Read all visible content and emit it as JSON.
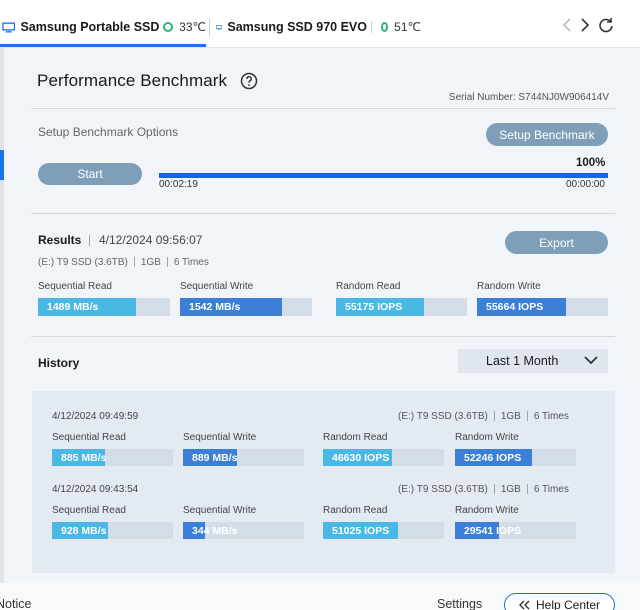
{
  "tabs": [
    {
      "name": "Samsung Portable SSD",
      "temp": "33℃",
      "active": true
    },
    {
      "name": "Samsung SSD 970 EVO",
      "temp": "51℃",
      "active": false
    }
  ],
  "colors": {
    "accent": "#1a73e8",
    "button": "#7f9fb8",
    "status_ok": "#2bb673",
    "bar_light": "#4ab8e4",
    "bar_dark": "#3b7fd6"
  },
  "benchmark": {
    "title": "Performance Benchmark",
    "serial": "Serial Number: S744NJ0W906414V",
    "setup_label": "Setup Benchmark Options",
    "setup_button": "Setup Benchmark",
    "start_button": "Start",
    "progress_percent_label": "100%",
    "progress_fraction": 1.0,
    "elapsed": "00:02:19",
    "remaining": "00:00:00"
  },
  "results": {
    "title": "Results",
    "date": "4/12/2024 09:56:07",
    "export_button": "Export",
    "drive": "(E:) T9 SSD (3.6TB)",
    "size": "1GB",
    "times": "6 Times",
    "metrics": [
      {
        "label": "Sequential Read",
        "value": "1489 MB/s",
        "fraction": 0.74
      },
      {
        "label": "Sequential Write",
        "value": "1542 MB/s",
        "fraction": 0.77
      },
      {
        "label": "Random Read",
        "value": "55175 IOPS",
        "fraction": 0.67
      },
      {
        "label": "Random Write",
        "value": "55664 IOPS",
        "fraction": 0.68
      }
    ]
  },
  "history": {
    "title": "History",
    "filter": "Last 1 Month",
    "entries": [
      {
        "date": "4/12/2024 09:49:59",
        "drive": "(E:) T9 SSD  (3.6TB)",
        "size": "1GB",
        "times": "6 Times",
        "metrics": [
          {
            "label": "Sequential Read",
            "value": "885 MB/s",
            "fraction": 0.44
          },
          {
            "label": "Sequential Write",
            "value": "889 MB/s",
            "fraction": 0.45
          },
          {
            "label": "Random Read",
            "value": "46630 IOPS",
            "fraction": 0.57
          },
          {
            "label": "Random Write",
            "value": "52246 IOPS",
            "fraction": 0.64
          }
        ]
      },
      {
        "date": "4/12/2024 09:43:54",
        "drive": "(E:) T9 SSD  (3.6TB)",
        "size": "1GB",
        "times": "6 Times",
        "metrics": [
          {
            "label": "Sequential Read",
            "value": "928 MB/s",
            "fraction": 0.46
          },
          {
            "label": "Sequential Write",
            "value": "344 MB/s",
            "fraction": 0.18
          },
          {
            "label": "Random Read",
            "value": "51025 IOPS",
            "fraction": 0.62
          },
          {
            "label": "Random Write",
            "value": "29541 IOPS",
            "fraction": 0.36
          }
        ]
      }
    ]
  },
  "footer": {
    "notice": "Notice",
    "settings": "Settings",
    "help_center": "Help Center"
  }
}
